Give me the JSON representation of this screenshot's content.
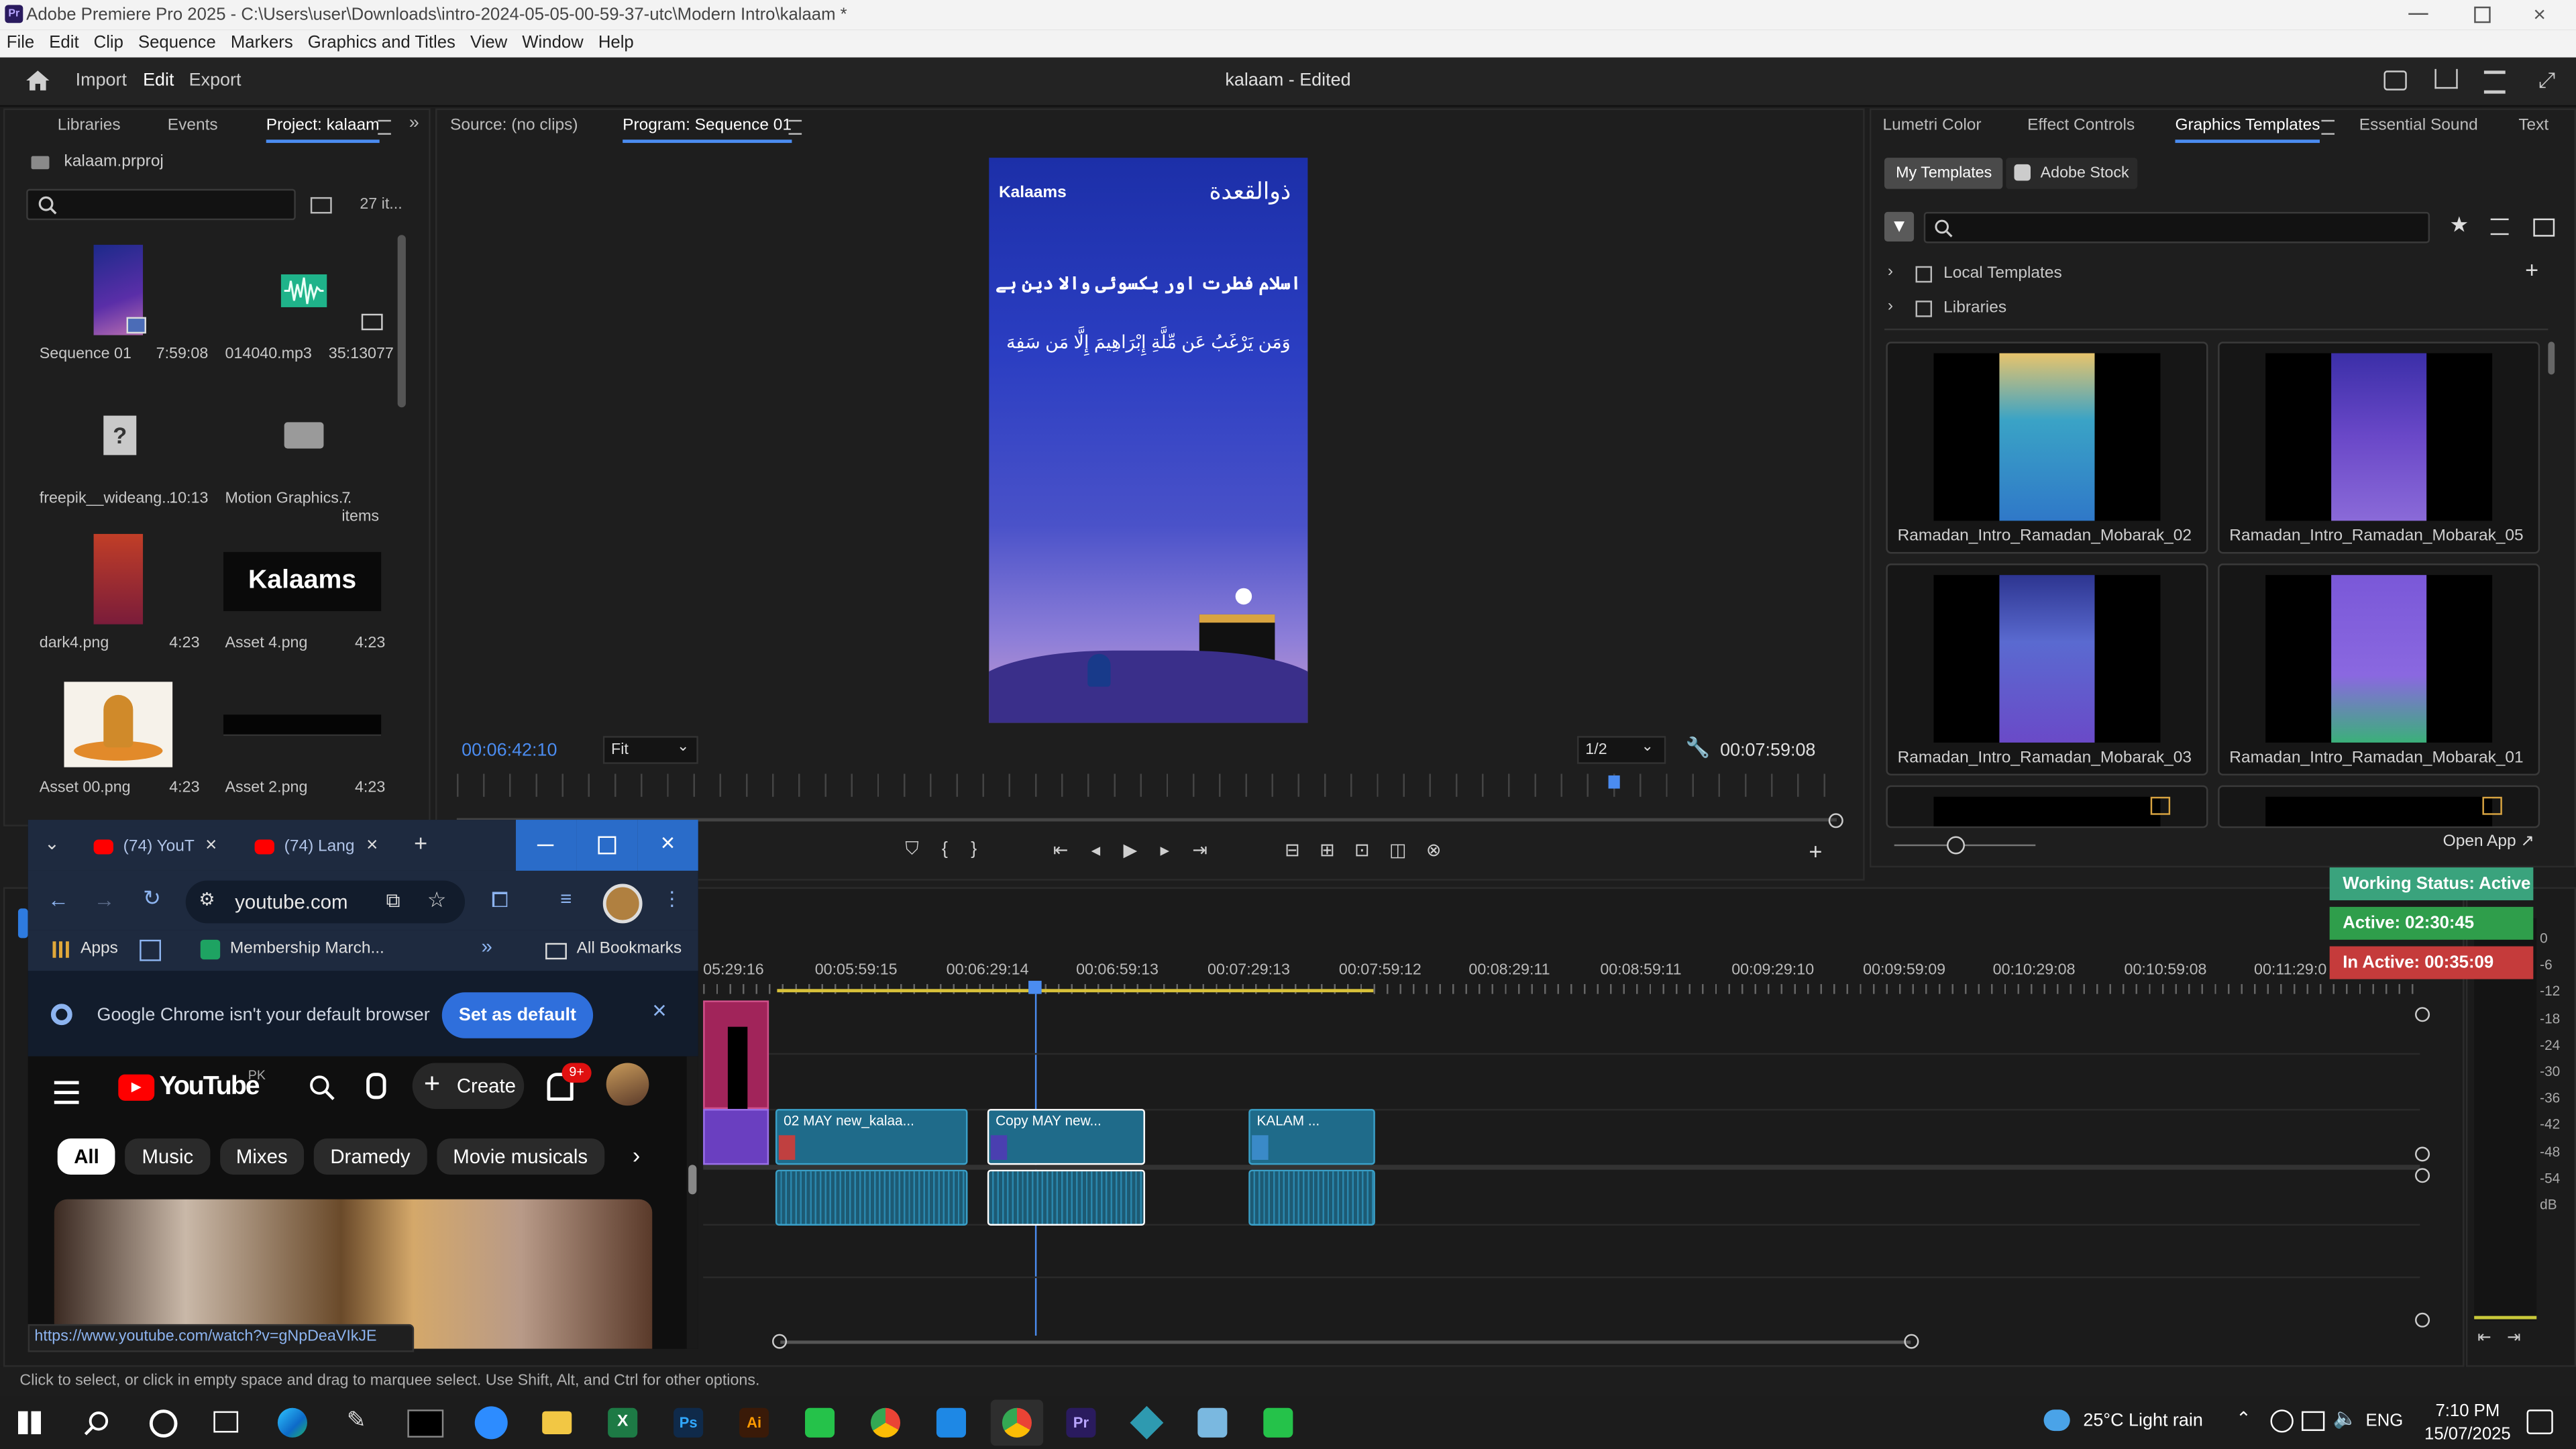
{
  "window": {
    "title": "Adobe Premiere Pro 2025 - C:\\Users\\user\\Downloads\\intro-2024-05-05-00-59-37-utc\\Modern Intro\\kalaam *",
    "app_icon": "Pr"
  },
  "menu": [
    "File",
    "Edit",
    "Clip",
    "Sequence",
    "Markers",
    "Graphics and Titles",
    "View",
    "Window",
    "Help"
  ],
  "header": {
    "tabs": [
      "Import",
      "Edit",
      "Export"
    ],
    "active": "Edit",
    "doc_title": "kalaam - Edited"
  },
  "project_panel": {
    "tabs": [
      "Libraries",
      "Events",
      "Project: kalaam"
    ],
    "file": "kalaam.prproj",
    "item_count": "27 it...",
    "items": [
      {
        "name": "Sequence 01",
        "meta": "7:59:08"
      },
      {
        "name": "014040.mp3",
        "meta": "35:13077"
      },
      {
        "name": "freepik__wideang...",
        "meta": "10:13"
      },
      {
        "name": "Motion Graphics...",
        "meta": "7 items"
      },
      {
        "name": "dark4.png",
        "meta": "4:23"
      },
      {
        "name": "Asset 4.png",
        "meta": "4:23"
      },
      {
        "name": "Asset 00.png",
        "meta": "4:23"
      },
      {
        "name": "Asset 2.png",
        "meta": "4:23"
      }
    ]
  },
  "monitor": {
    "tabs": [
      "Source: (no clips)",
      "Program: Sequence 01"
    ],
    "timecode": "00:06:42:10",
    "fit": "Fit",
    "resolution": "1/2",
    "duration": "00:07:59:08",
    "preview": {
      "brand": "Kalaams",
      "urdu_line": "اسلام فطرت اور یکسوئی والا دین ہے",
      "arabic_line": "وَمَن يَرْغَبُ عَن مِّلَّةِ إِبْرَاهِيمَ إِلَّا مَن سَفِهَ",
      "corner_text": "ذوالقعدة"
    }
  },
  "right_panel": {
    "tabs": [
      "Lumetri Color",
      "Effect Controls",
      "Graphics Templates",
      "Essential Sound",
      "Text"
    ],
    "subtabs": [
      "My Templates",
      "Adobe Stock"
    ],
    "tree": [
      "Local Templates",
      "Libraries"
    ],
    "templates": [
      "Ramadan_Intro_Ramadan_Mobarak_02",
      "Ramadan_Intro_Ramadan_Mobarak_05",
      "Ramadan_Intro_Ramadan_Mobarak_03",
      "Ramadan_Intro_Ramadan_Mobarak_01"
    ],
    "open_app": "Open App"
  },
  "status_widget": {
    "working": "Working Status: Active",
    "active": "Active: 02:30:45",
    "inactive": "In Active: 00:35:09",
    "colors": {
      "working": "#3aa37d",
      "active": "#2f9e4b",
      "inactive": "#c53b3b"
    }
  },
  "timeline": {
    "ruler": [
      "05:29:16",
      "00:05:59:15",
      "00:06:29:14",
      "00:06:59:13",
      "00:07:29:13",
      "00:07:59:12",
      "00:08:29:11",
      "00:08:59:11",
      "00:09:29:10",
      "00:09:59:09",
      "00:10:29:08",
      "00:10:59:08",
      "00:11:29:0"
    ],
    "clips": [
      "02 MAY new_kalaa...",
      "Copy MAY new...",
      "KALAM ..."
    ],
    "meter_scale": [
      "0",
      "-6",
      "-12",
      "-18",
      "-24",
      "-30",
      "-36",
      "-42",
      "-48",
      "-54",
      "dB"
    ]
  },
  "chrome": {
    "tabs": [
      "(74) YouT",
      "(74) Lang"
    ],
    "url": "youtube.com",
    "bookmarks": [
      "Apps",
      "Membership March...",
      "All Bookmarks"
    ],
    "notice": "Google Chrome isn't your default browser",
    "set_default": "Set as default",
    "youtube": {
      "logo_text": "YouTube",
      "region": "PK",
      "create": "Create",
      "badge": "9+",
      "chips": [
        "All",
        "Music",
        "Mixes",
        "Dramedy",
        "Movie musicals"
      ]
    },
    "status_url": "https://www.youtube.com/watch?v=gNpDeaVIkJE"
  },
  "status_bar": "Click to select, or click in empty space and drag to marquee select. Use Shift, Alt, and Ctrl for other options.",
  "taskbar": {
    "weather": "25°C Light rain",
    "lang": "ENG",
    "time": "7:10 PM",
    "date": "15/07/2025",
    "apps": [
      "start-icon",
      "search-icon",
      "cortana-icon",
      "task-view-icon",
      "edge-icon",
      "pen-icon",
      "terminal-icon",
      "zoom-icon",
      "file-explorer-icon",
      "excel-icon",
      "photoshop-icon",
      "illustrator-icon",
      "whatsapp-icon",
      "chrome-icon",
      "vscode-icon",
      "chrome-profile-icon",
      "premiere-icon",
      "app-icon",
      "notepad-icon",
      "whatsapp2-icon"
    ]
  }
}
